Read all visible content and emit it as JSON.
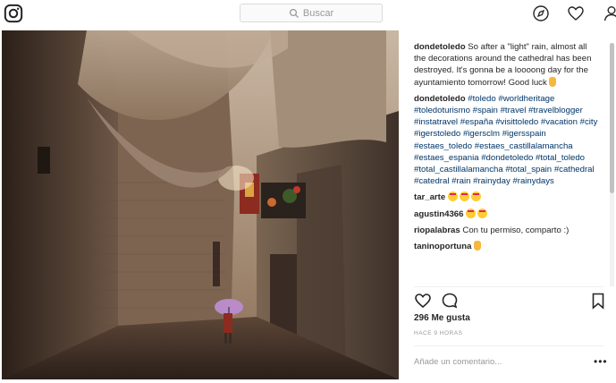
{
  "search": {
    "placeholder": "Buscar"
  },
  "icons": {
    "logo": "instagram-logo-icon",
    "explore": "compass-icon",
    "activity": "heart-icon",
    "profile": "user-icon"
  },
  "post": {
    "caption_user": "dondetoledo",
    "caption_text": "So after a \"light\" rain, almost all the decorations around the cathedral has been destroyed. It's gonna be a loooong day for the ayuntamiento tomorrow! Good luck",
    "hashtag_user": "dondetoledo",
    "hashtags": [
      "#toledo",
      "#worldheritage",
      "#toledoturismo",
      "#spain",
      "#travel",
      "#travelblogger",
      "#instatravel",
      "#españa",
      "#visittoledo",
      "#vacation",
      "#city",
      "#igerstoledo",
      "#igersclm",
      "#igersspain",
      "#estaes_toledo",
      "#estaes_castillalamancha",
      "#estaes_espania",
      "#dondetoledo",
      "#total_toledo",
      "#total_castillalamancha",
      "#total_spain",
      "#cathedral",
      "#catedral",
      "#rain",
      "#rainyday",
      "#rainydays"
    ],
    "comments": [
      {
        "user": "tar_arte",
        "text": "",
        "emojis": 3
      },
      {
        "user": "agustin4366",
        "text": "",
        "emojis": 2
      },
      {
        "user": "riopalabras",
        "text": "Con tu permiso, comparto :)",
        "emojis": 0
      },
      {
        "user": "taninoportuna",
        "text": "",
        "emojis": 0
      }
    ],
    "likes": "296 Me gusta",
    "time": "HACE 9 HORAS",
    "add_comment_placeholder": "Añade un comentario...",
    "more": "•••"
  },
  "colors": {
    "link": "#003569",
    "muted": "#999999",
    "border": "#dbdbdb"
  }
}
